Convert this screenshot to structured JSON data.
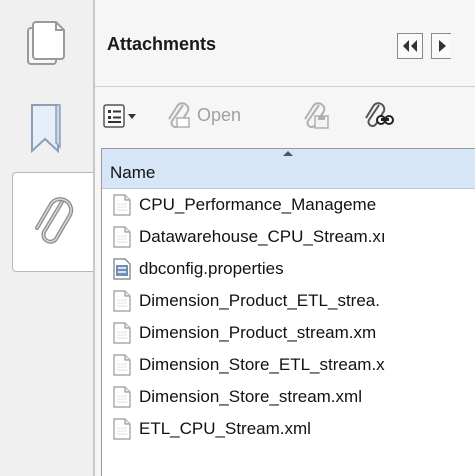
{
  "panel": {
    "title": "Attachments"
  },
  "toolbar": {
    "open_label": "Open"
  },
  "list": {
    "column_header": "Name",
    "files": [
      {
        "name": "CPU_Performance_Manageme",
        "icon": "document-icon"
      },
      {
        "name": "Datawarehouse_CPU_Stream.xı",
        "icon": "document-icon"
      },
      {
        "name": "dbconfig.properties",
        "icon": "properties-file-icon"
      },
      {
        "name": "Dimension_Product_ETL_strea.",
        "icon": "document-icon"
      },
      {
        "name": "Dimension_Product_stream.xm",
        "icon": "document-icon"
      },
      {
        "name": "Dimension_Store_ETL_stream.x",
        "icon": "document-icon"
      },
      {
        "name": "Dimension_Store_stream.xml",
        "icon": "document-icon"
      },
      {
        "name": "ETL_CPU_Stream.xml",
        "icon": "document-icon"
      }
    ]
  },
  "colors": {
    "header_bg": "#d6e6f7",
    "panel_bg": "#f6f6f6",
    "rail_bg": "#f0f0f0"
  }
}
